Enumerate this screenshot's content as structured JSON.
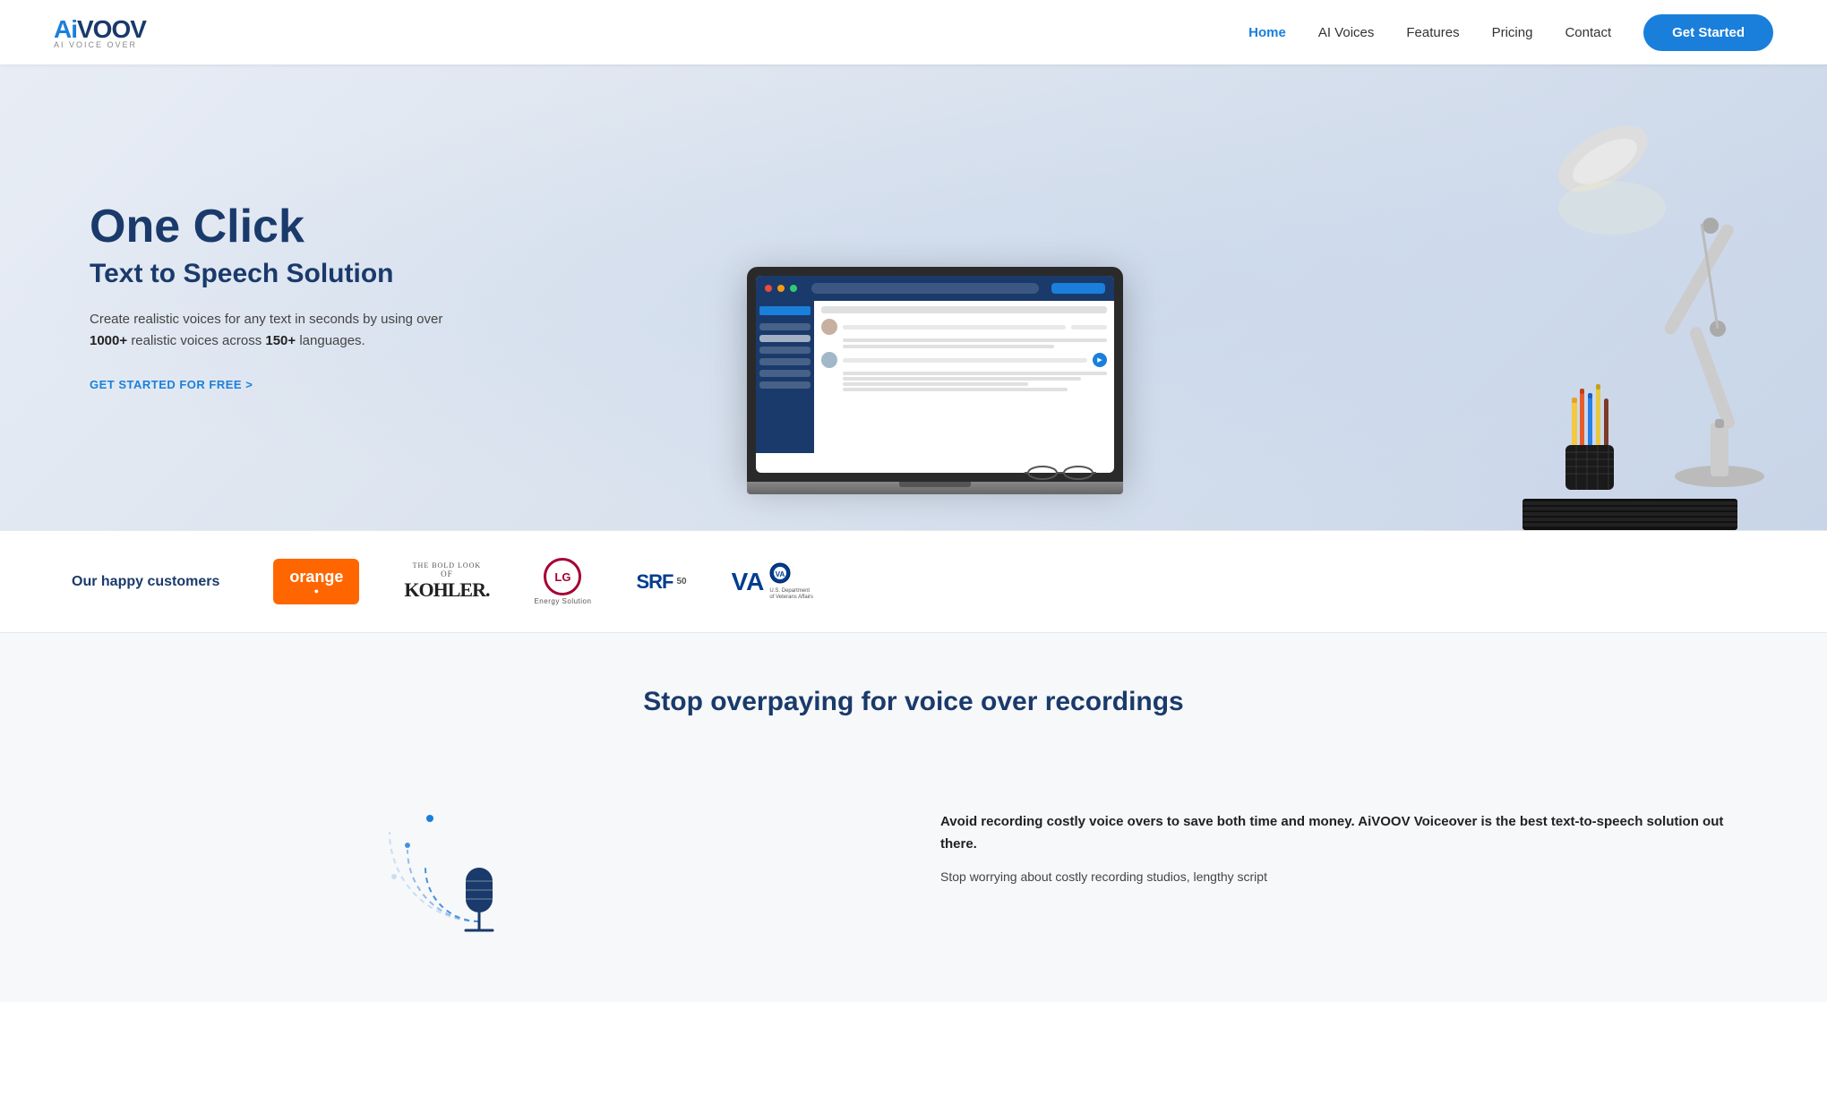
{
  "brand": {
    "name_prefix": "Ai",
    "name_main": "VOOV",
    "tagline": "AI VOICE OVER"
  },
  "nav": {
    "links": [
      {
        "id": "home",
        "label": "Home",
        "active": true
      },
      {
        "id": "ai-voices",
        "label": "AI Voices",
        "active": false
      },
      {
        "id": "features",
        "label": "Features",
        "active": false
      },
      {
        "id": "pricing",
        "label": "Pricing",
        "active": false
      },
      {
        "id": "contact",
        "label": "Contact",
        "active": false
      }
    ],
    "cta_label": "Get Started"
  },
  "hero": {
    "title_line1": "One Click",
    "title_line2": "Text to Speech Solution",
    "description_pre": "Create realistic voices for any text in seconds by using over ",
    "bold1": "1000+",
    "description_mid": " realistic voices across ",
    "bold2": "150+",
    "description_post": " languages.",
    "cta_label": "GET STARTED FOR FREE >"
  },
  "customers": {
    "label": "Our happy customers",
    "logos": [
      {
        "id": "orange",
        "display": "orange"
      },
      {
        "id": "kohler",
        "display": "KOHLER."
      },
      {
        "id": "lg",
        "display": "LG Energy Solution"
      },
      {
        "id": "srf",
        "display": "SRF"
      },
      {
        "id": "va",
        "display": "VA"
      }
    ]
  },
  "section2": {
    "title": "Stop overpaying for voice over recordings",
    "para1_bold": "Avoid recording costly voice overs to save both time and money. AiVOOV Voiceover is the best text-to-speech solution out there.",
    "para2": "Stop worrying about costly recording studios, lengthy script"
  }
}
